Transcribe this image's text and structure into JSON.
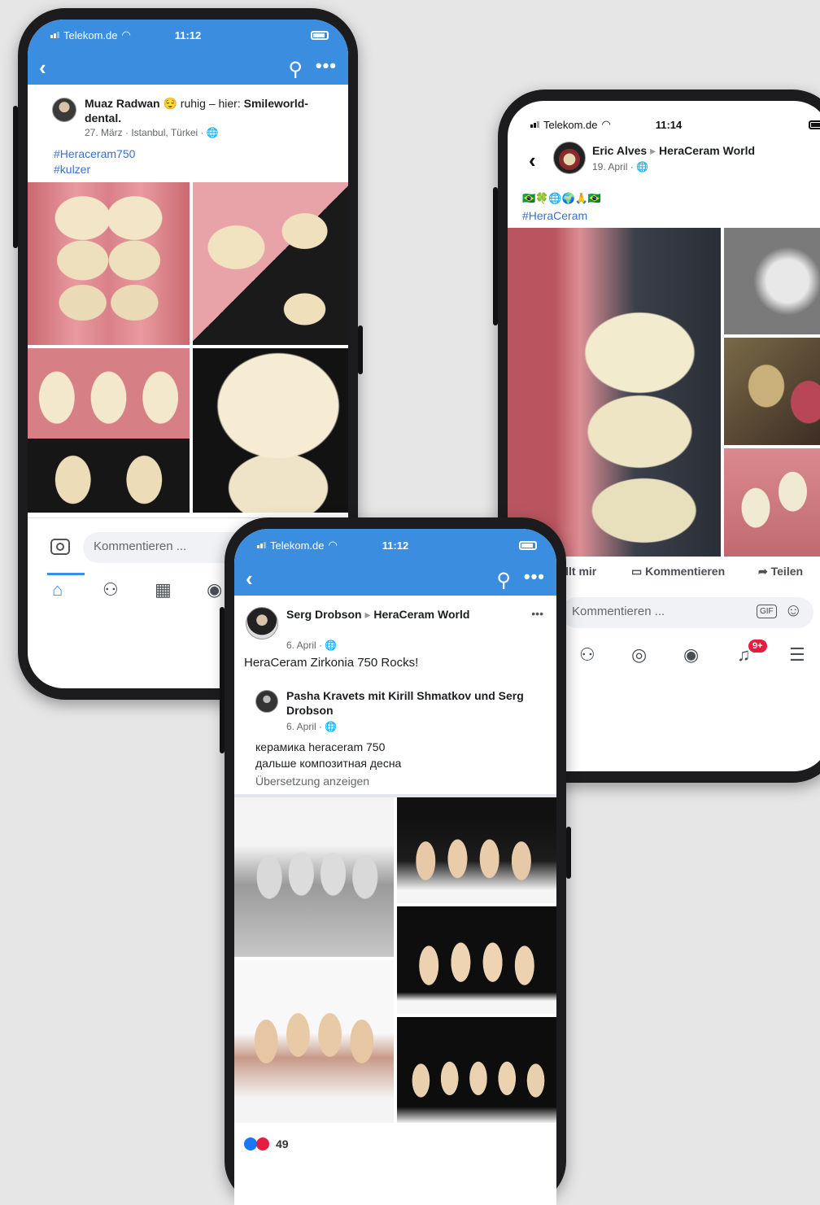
{
  "colors": {
    "fb_blue": "#3b8de0",
    "link": "#3b6fcf",
    "badge": "#e41e3f",
    "background": "#e6e6e6"
  },
  "phone1": {
    "status": {
      "carrier": "Telekom.de",
      "time": "11:12"
    },
    "post": {
      "author": "Muaz Radwan",
      "emoji": "😌",
      "activity": "ruhig – hier:",
      "place": "Smileworld-dental.",
      "meta": "27. März · Istanbul, Türkei · 🌐",
      "tags": [
        "#Heraceram750",
        "#kulzer"
      ]
    },
    "comment_placeholder": "Kommentieren ..."
  },
  "phone2": {
    "status": {
      "carrier": "Telekom.de",
      "time": "11:14"
    },
    "post": {
      "author": "Eric Alves",
      "target": "HeraCeram World",
      "meta": "19. April · 🌐",
      "emojis": "🇧🇷🍀🌐🌍🙏🇧🇷",
      "tag": "#HeraCeram"
    },
    "actions": {
      "like": "Gefällt mir",
      "comment": "Kommentieren",
      "share": "Teilen"
    },
    "comment_placeholder": "Kommentieren ...",
    "gif_label": "GIF",
    "notification_badge": "9+"
  },
  "phone3": {
    "status": {
      "carrier": "Telekom.de",
      "time": "11:12"
    },
    "post": {
      "author": "Serg Drobson",
      "target": "HeraCeram World",
      "meta": "6. April · 🌐",
      "text": "HeraCeram Zirkonia 750 Rocks!"
    },
    "shared": {
      "author_line": "Pasha Kravets mit Kirill Shmatkov und Serg Drobson",
      "meta": "6. April · 🌐",
      "text_line1": "керамика heraceram 750",
      "text_line2": "дальше композитная десна",
      "translate": "Übersetzung anzeigen"
    },
    "reactions_count": "49"
  }
}
